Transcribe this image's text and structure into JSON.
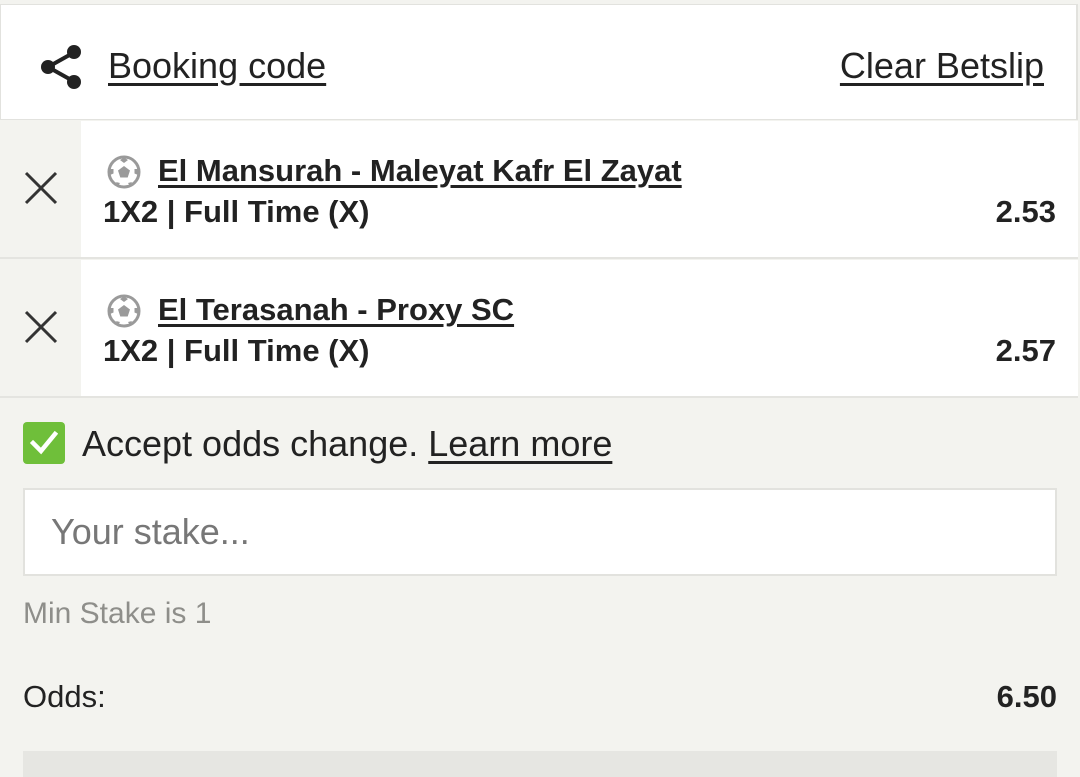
{
  "header": {
    "booking_code_label": "Booking code",
    "clear_betslip_label": "Clear Betslip"
  },
  "selections": [
    {
      "match": "El Mansurah - Maleyat Kafr El Zayat",
      "market": "1X2 | Full Time (X)",
      "odds": "2.53",
      "icon": "soccer-ball-icon"
    },
    {
      "match": "El Terasanah - Proxy SC",
      "market": "1X2 | Full Time (X)",
      "odds": "2.57",
      "icon": "soccer-ball-icon"
    }
  ],
  "accept_odds": {
    "checked": true,
    "label": "Accept odds change.",
    "learn_more": "Learn more"
  },
  "stake": {
    "placeholder": "Your stake...",
    "value": "",
    "min_stake_text": "Min Stake is 1"
  },
  "summary": {
    "odds_label": "Odds:",
    "odds_value": "6.50"
  },
  "colors": {
    "checkbox_green": "#6fbf3a",
    "background": "#f3f3ef",
    "card": "#ffffff"
  }
}
